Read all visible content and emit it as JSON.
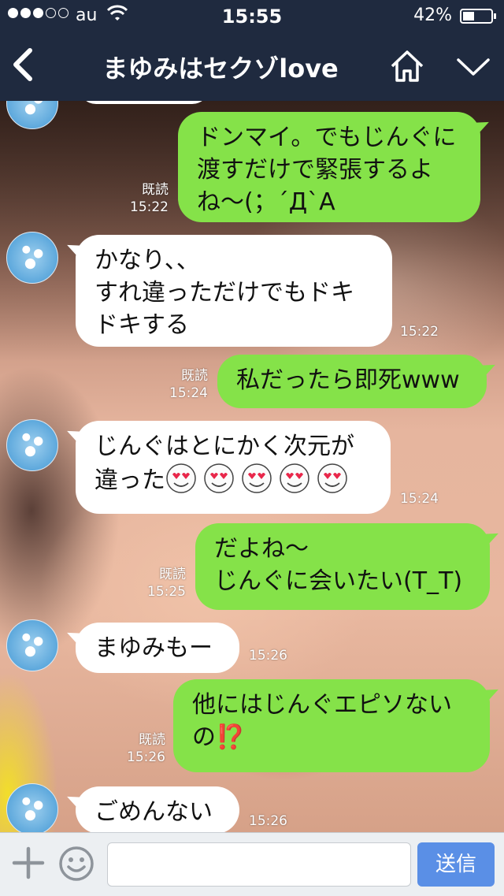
{
  "status_bar": {
    "carrier": "au",
    "time": "15:55",
    "battery_percent": "42%",
    "battery_level": 0.42,
    "signal_bars_filled": 3,
    "signal_bars_total": 5
  },
  "nav": {
    "back_icon": "chevron-left-icon",
    "title": "まゆみはセクゾlove",
    "home_icon": "home-icon",
    "menu_icon": "chevron-down-icon"
  },
  "messages": [
    {
      "direction": "out",
      "text": "ドンマイ。でもじんぐに渡すだけで緊張するよね〜(；´Д`A",
      "read": "既読",
      "time": "15:22"
    },
    {
      "direction": "in",
      "text": "かなり、、\nすれ違っただけでもドキドキする",
      "time": "15:22"
    },
    {
      "direction": "out",
      "text": "私だったら即死www",
      "read": "既読",
      "time": "15:24"
    },
    {
      "direction": "in",
      "text": "じんぐはとにかく次元が\n違った",
      "emoji": "heart-eyes-emoji",
      "emoji_count": 5,
      "time": "15:24"
    },
    {
      "direction": "out",
      "text": "だよね〜\nじんぐに会いたい(T_T)",
      "read": "既読",
      "time": "15:25"
    },
    {
      "direction": "in",
      "text": "まゆみもー",
      "time": "15:26"
    },
    {
      "direction": "out",
      "text": "他にはじんぐエピソないの⁉️",
      "read": "既読",
      "time": "15:26"
    },
    {
      "direction": "in",
      "text": "ごめんない",
      "time": "15:26"
    }
  ],
  "input_bar": {
    "plus_icon": "plus-icon",
    "sticker_icon": "smiley-icon",
    "placeholder": "",
    "send_label": "送信"
  },
  "colors": {
    "header_bg": "#1f2a3f",
    "outgoing_bubble": "#85e249",
    "incoming_bubble": "#ffffff",
    "send_button": "#5a8fe6"
  }
}
